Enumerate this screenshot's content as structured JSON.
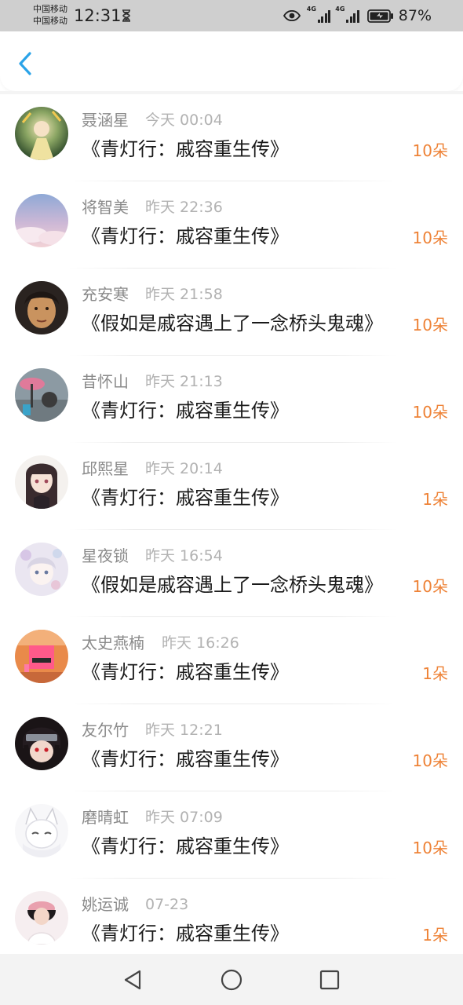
{
  "status_bar": {
    "carrier_1": "中国移动",
    "carrier_2": "中国移动",
    "time": "12:31",
    "network_1": "4G",
    "network_2": "4G",
    "battery_percent": "87%"
  },
  "header": {
    "back_icon": "chevron-left-icon",
    "accent_color": "#2aa3e8"
  },
  "list": {
    "count_color": "#ee8236",
    "items": [
      {
        "name": "聂涵星",
        "time": "今天 00:04",
        "book": "《青灯行：戚容重生传》",
        "count": "10朵"
      },
      {
        "name": "将智美",
        "time": "昨天 22:36",
        "book": "《青灯行：戚容重生传》",
        "count": "10朵"
      },
      {
        "name": "充安寒",
        "time": "昨天 21:58",
        "book": "《假如是戚容遇上了一念桥头鬼魂》",
        "count": "10朵"
      },
      {
        "name": "昔怀山",
        "time": "昨天 21:13",
        "book": "《青灯行：戚容重生传》",
        "count": "10朵"
      },
      {
        "name": "邱熙星",
        "time": "昨天 20:14",
        "book": "《青灯行：戚容重生传》",
        "count": "1朵"
      },
      {
        "name": "星夜锁",
        "time": "昨天 16:54",
        "book": "《假如是戚容遇上了一念桥头鬼魂》",
        "count": "10朵"
      },
      {
        "name": "太史燕楠",
        "time": "昨天 16:26",
        "book": "《青灯行：戚容重生传》",
        "count": "1朵"
      },
      {
        "name": "友尔竹",
        "time": "昨天 12:21",
        "book": "《青灯行：戚容重生传》",
        "count": "10朵"
      },
      {
        "name": "磨晴虹",
        "time": "昨天 07:09",
        "book": "《青灯行：戚容重生传》",
        "count": "10朵"
      },
      {
        "name": "姚运诚",
        "time": "07-23",
        "book": "《青灯行：戚容重生传》",
        "count": "1朵"
      }
    ]
  },
  "nav_bar": {
    "back": "triangle-back-icon",
    "home": "circle-home-icon",
    "recents": "square-recents-icon"
  }
}
